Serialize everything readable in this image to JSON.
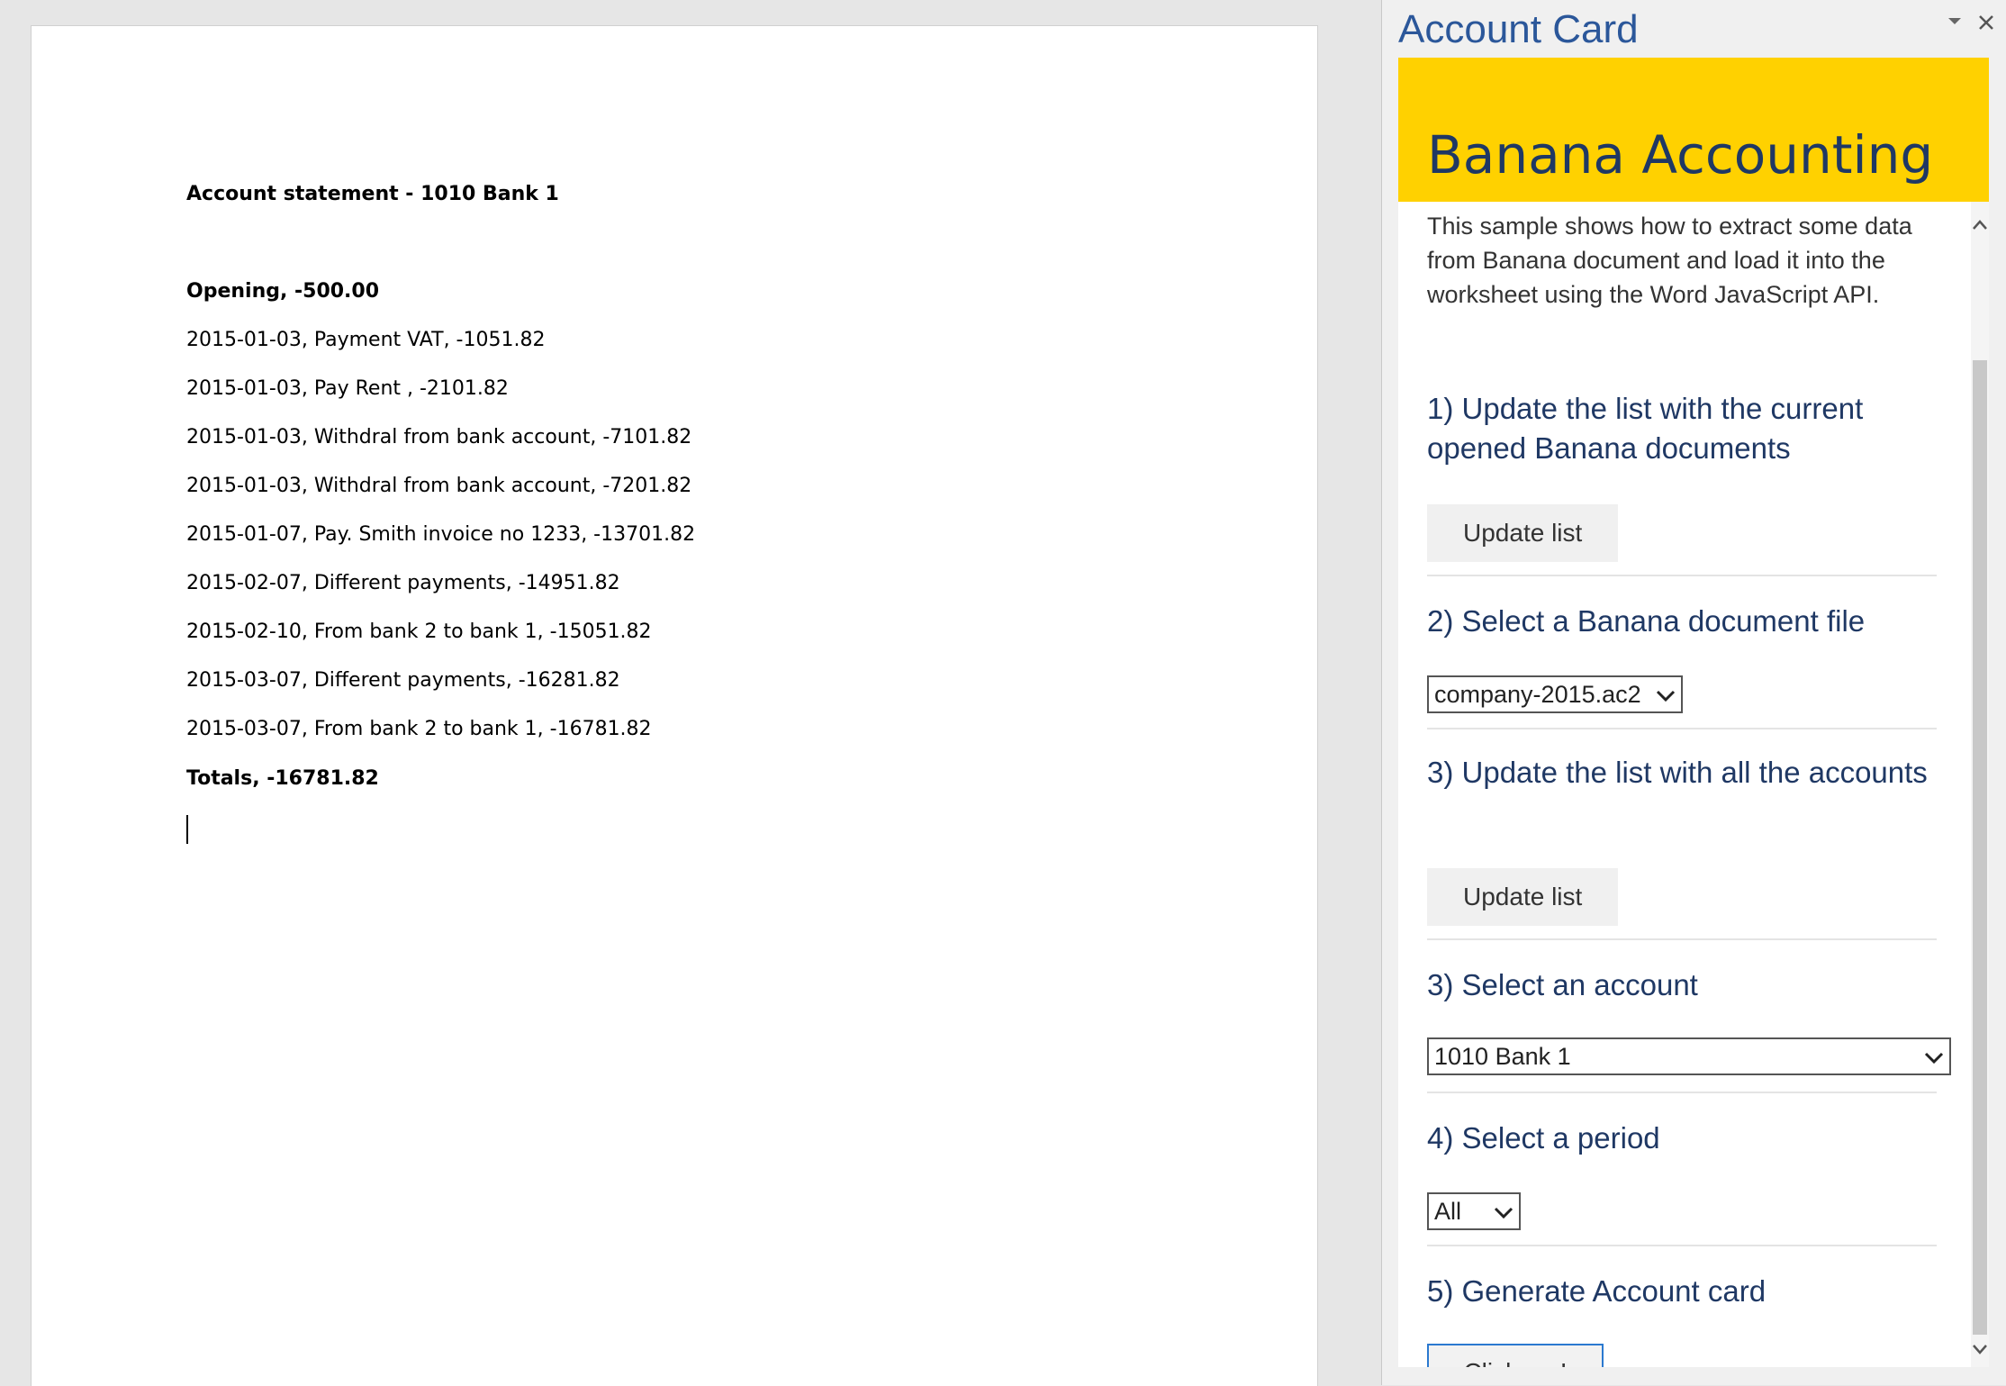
{
  "document": {
    "title_line": "Account statement - 1010 Bank 1",
    "opening_line": "Opening, -500.00",
    "lines": [
      "2015-01-03, Payment VAT, -1051.82",
      "2015-01-03, Pay Rent , -2101.82",
      "2015-01-03, Withdral from bank account, -7101.82",
      "2015-01-03, Withdral from bank account, -7201.82",
      "2015-01-07, Pay. Smith invoice no 1233, -13701.82",
      "2015-02-07, Different payments, -14951.82",
      "2015-02-10, From bank 2 to bank 1, -15051.82",
      "2015-03-07, Different payments, -16281.82",
      "2015-03-07, From bank 2 to bank 1, -16781.82"
    ],
    "totals_line": "Totals, -16781.82"
  },
  "task_pane": {
    "title": "Account Card",
    "menu_icon": "chevron-down-icon",
    "close_icon": "close-icon"
  },
  "addin": {
    "heading": "Banana Accounting",
    "header_color": "#ffd100",
    "intro": "This sample shows how to extract some data from Banana document and load it into the worksheet using the Word JavaScript API.",
    "step1_title": "1) Update the list with the current opened Banana documents",
    "step1_button": "Update list",
    "step2_title": "2) Select a Banana document file",
    "step2_selected": "company-2015.ac2",
    "step3a_title": "3) Update the list with all the accounts",
    "step3a_button": "Update list",
    "step3b_title": "3) Select an account",
    "step3b_selected": "1010 Bank 1",
    "step4_title": "4) Select a period",
    "step4_selected": "All",
    "step5_title": "5) Generate Account card",
    "step5_button": "Click me!"
  }
}
